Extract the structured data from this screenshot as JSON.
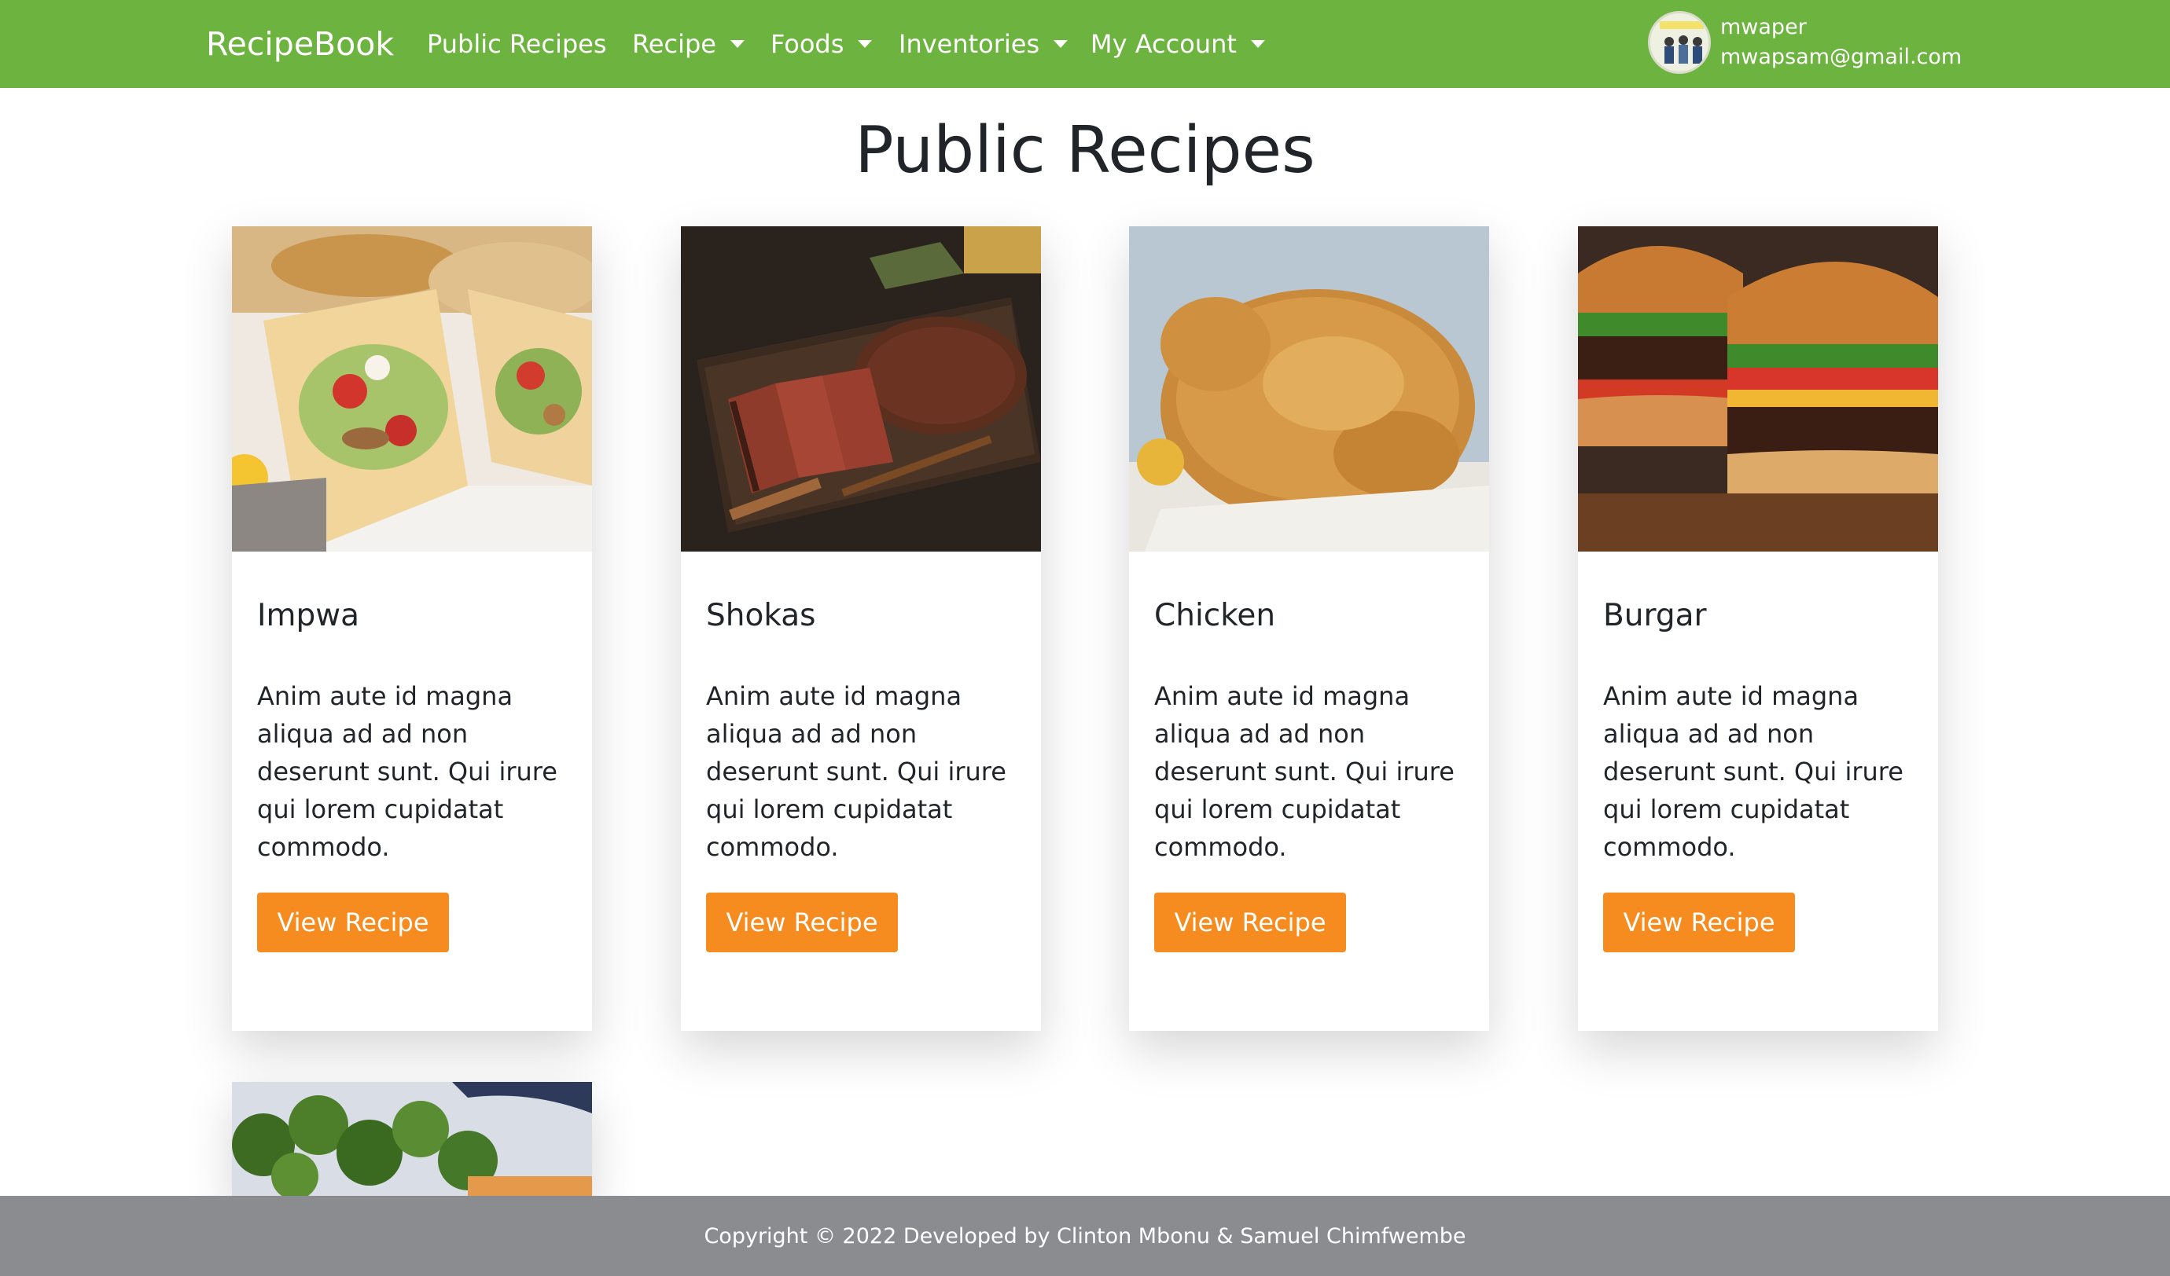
{
  "navbar": {
    "brand": "RecipeBook",
    "links": [
      {
        "label": "Public Recipes"
      },
      {
        "label": "Recipe"
      },
      {
        "label": "Foods"
      },
      {
        "label": "Inventories"
      },
      {
        "label": "My Account"
      }
    ],
    "user": {
      "name": "mwaper",
      "email": "mwapsam@gmail.com"
    }
  },
  "page": {
    "title": "Public Recipes"
  },
  "recipes": [
    {
      "name": "Impwa",
      "description": "Anim aute id magna aliqua ad ad non deserunt sunt. Qui irure qui lorem cupidatat commodo.",
      "button": "View Recipe"
    },
    {
      "name": "Shokas",
      "description": "Anim aute id magna aliqua ad ad non deserunt sunt. Qui irure qui lorem cupidatat commodo.",
      "button": "View Recipe"
    },
    {
      "name": "Chicken",
      "description": "Anim aute id magna aliqua ad ad non deserunt sunt. Qui irure qui lorem cupidatat commodo.",
      "button": "View Recipe"
    },
    {
      "name": "Burgar",
      "description": "Anim aute id magna aliqua ad ad non deserunt sunt. Qui irure qui lorem cupidatat commodo.",
      "button": "View Recipe"
    }
  ],
  "footer": {
    "text": "Copyright © 2022 Developed by Clinton Mbonu & Samuel Chimfwembe"
  },
  "colors": {
    "navbar": "#6db33f",
    "button": "#f68b1f",
    "footer": "#8a8c90"
  }
}
